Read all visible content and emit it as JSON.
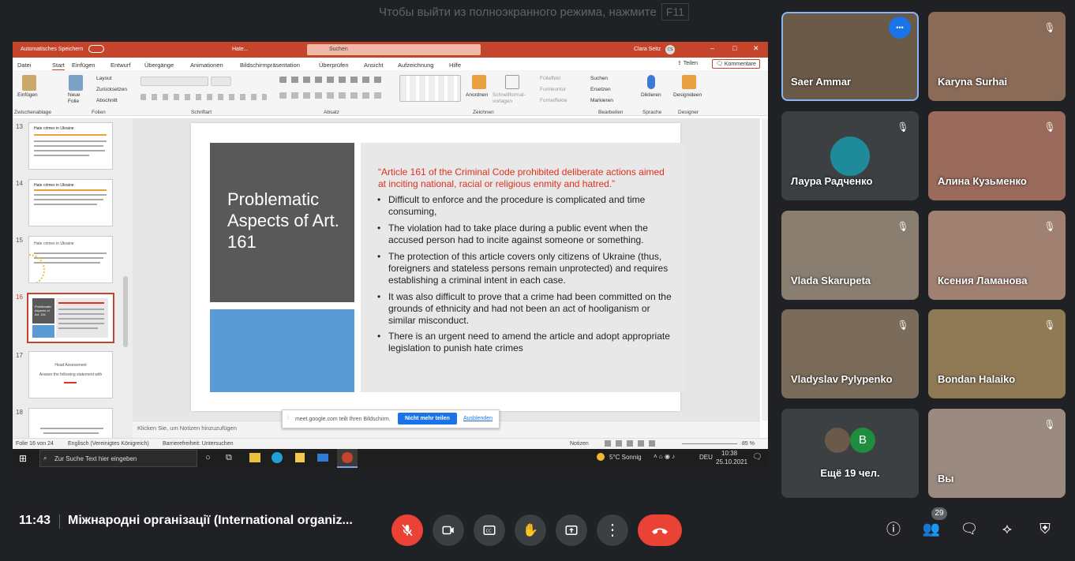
{
  "fullscreen_hint": {
    "text": "Чтобы выйти из полноэкранного режима, нажмите",
    "key": "F11"
  },
  "ppt": {
    "titlebar": {
      "autosave": "Automatisches Speichern",
      "file": "Hate...",
      "search": "Suchen",
      "user": "Clara Seitz",
      "user_initials": "CS"
    },
    "menu": [
      "Datei",
      "Start",
      "Einfügen",
      "Entwurf",
      "Übergänge",
      "Animationen",
      "Bildschirmpräsentation",
      "Überprüfen",
      "Ansicht",
      "Aufzeichnung",
      "Hilfe"
    ],
    "share_label": "Teilen",
    "comments_label": "Kommentare",
    "ribbon": {
      "einfuegen": "Einfügen",
      "neue_folie": "Neue Folie",
      "layout": "Layout",
      "zuruecksetzen": "Zurücksetzen",
      "abschnitt": "Abschnitt",
      "anordnen": "Anordnen",
      "schnellformatvorlagen": "Schnellformat-vorlagen",
      "fuelleffekt": "Fülleffekt",
      "formkontur": "Formkontur",
      "formeffekte": "Formeffekte",
      "suchen": "Suchen",
      "ersetzen": "Ersetzen",
      "markieren": "Markieren",
      "diktieren": "Diktieren",
      "designideen": "Designideen",
      "groups": [
        "Zwischenablage",
        "Folien",
        "Schriftart",
        "Absatz",
        "Zeichnen",
        "Bearbeiten",
        "Sprache",
        "Designer"
      ]
    },
    "thumbnails": [
      {
        "num": "13",
        "title": "Hate crimes in Ukraine"
      },
      {
        "num": "14",
        "title": "Hate crimes in Ukraine"
      },
      {
        "num": "15",
        "title": "Hate crimes in Ukraine"
      },
      {
        "num": "16",
        "title": "Problematic Aspects of Art. 161"
      },
      {
        "num": "17",
        "title": "Head Assessment",
        "sub": "Answer the following statement with"
      },
      {
        "num": "18",
        "title": ""
      }
    ],
    "slide": {
      "title": "Problematic Aspects of Art. 161",
      "quote": "“Article 161 of the Criminal Code prohibited deliberate actions aimed at inciting national, racial or religious enmity and hatred.”",
      "bullets": [
        "Difficult to enforce and the procedure is complicated and time consuming,",
        "The violation had to take place during a public event when the accused person had to incite against someone or something.",
        " The protection of this article covers only citizens of Ukraine (thus, foreigners and stateless persons remain unprotected) and requires establishing a criminal intent in each case.",
        "It was also difficult to prove that a crime had been committed on the grounds of ethnicity and had not been an act of hooliganism or similar misconduct.",
        "There is an urgent need to amend the article and adopt appropriate legislation to punish hate crimes"
      ]
    },
    "notes_placeholder": "Klicken Sie, um Notizen hinzuzufügen",
    "share_bar": {
      "text": "meet.google.com teilt Ihren Bildschirm.",
      "stop": "Nicht mehr teilen",
      "hide": "Ausblenden"
    },
    "status": {
      "slide": "Folie 16 von 24",
      "lang": "Englisch (Vereinigtes Königreich)",
      "access": "Barrierefreiheit: Untersuchen",
      "notes": "Notizen",
      "zoom": "85 %"
    },
    "taskbar": {
      "search": "Zur Suche Text hier eingeben",
      "weather": "5°C  Sonnig",
      "lang": "DEU",
      "time": "10:38",
      "date": "25.10.2021"
    }
  },
  "participants": [
    {
      "name": "Saer Ammar",
      "muted": false,
      "bg": "#6b5a48"
    },
    {
      "name": "Karyna Surhai",
      "muted": true,
      "bg": "#8a6b58"
    },
    {
      "name": "Лаура Радченко",
      "muted": true,
      "bg": "#3c4043"
    },
    {
      "name": "Алина Кузьменко",
      "muted": true,
      "bg": "#9a6a5a"
    },
    {
      "name": "Vlada Skarupeta",
      "muted": true,
      "bg": "#8a7e70"
    },
    {
      "name": "Ксения Ламанова",
      "muted": true,
      "bg": "#a08070"
    },
    {
      "name": "Vladyslav Pylypenko",
      "muted": true,
      "bg": "#7a6b5a"
    },
    {
      "name": "Bondan Halaiko",
      "muted": true,
      "bg": "#8f7a55"
    },
    {
      "name": "Ещё 19 чел.",
      "muted": false,
      "bg": "#3c4043"
    },
    {
      "name": "Вы",
      "muted": true,
      "bg": "#9a8a80"
    }
  ],
  "more_avatar_letter": "B",
  "bottom": {
    "time": "11:43",
    "meeting": "Міжнародні організації (International organiz...",
    "people_count": "29"
  },
  "colors": {
    "accent": "#c4452b",
    "end_call": "#ea4335",
    "mic_off": "#ea4335",
    "meet_bg": "#202124",
    "tile_bg": "#3c4043"
  }
}
